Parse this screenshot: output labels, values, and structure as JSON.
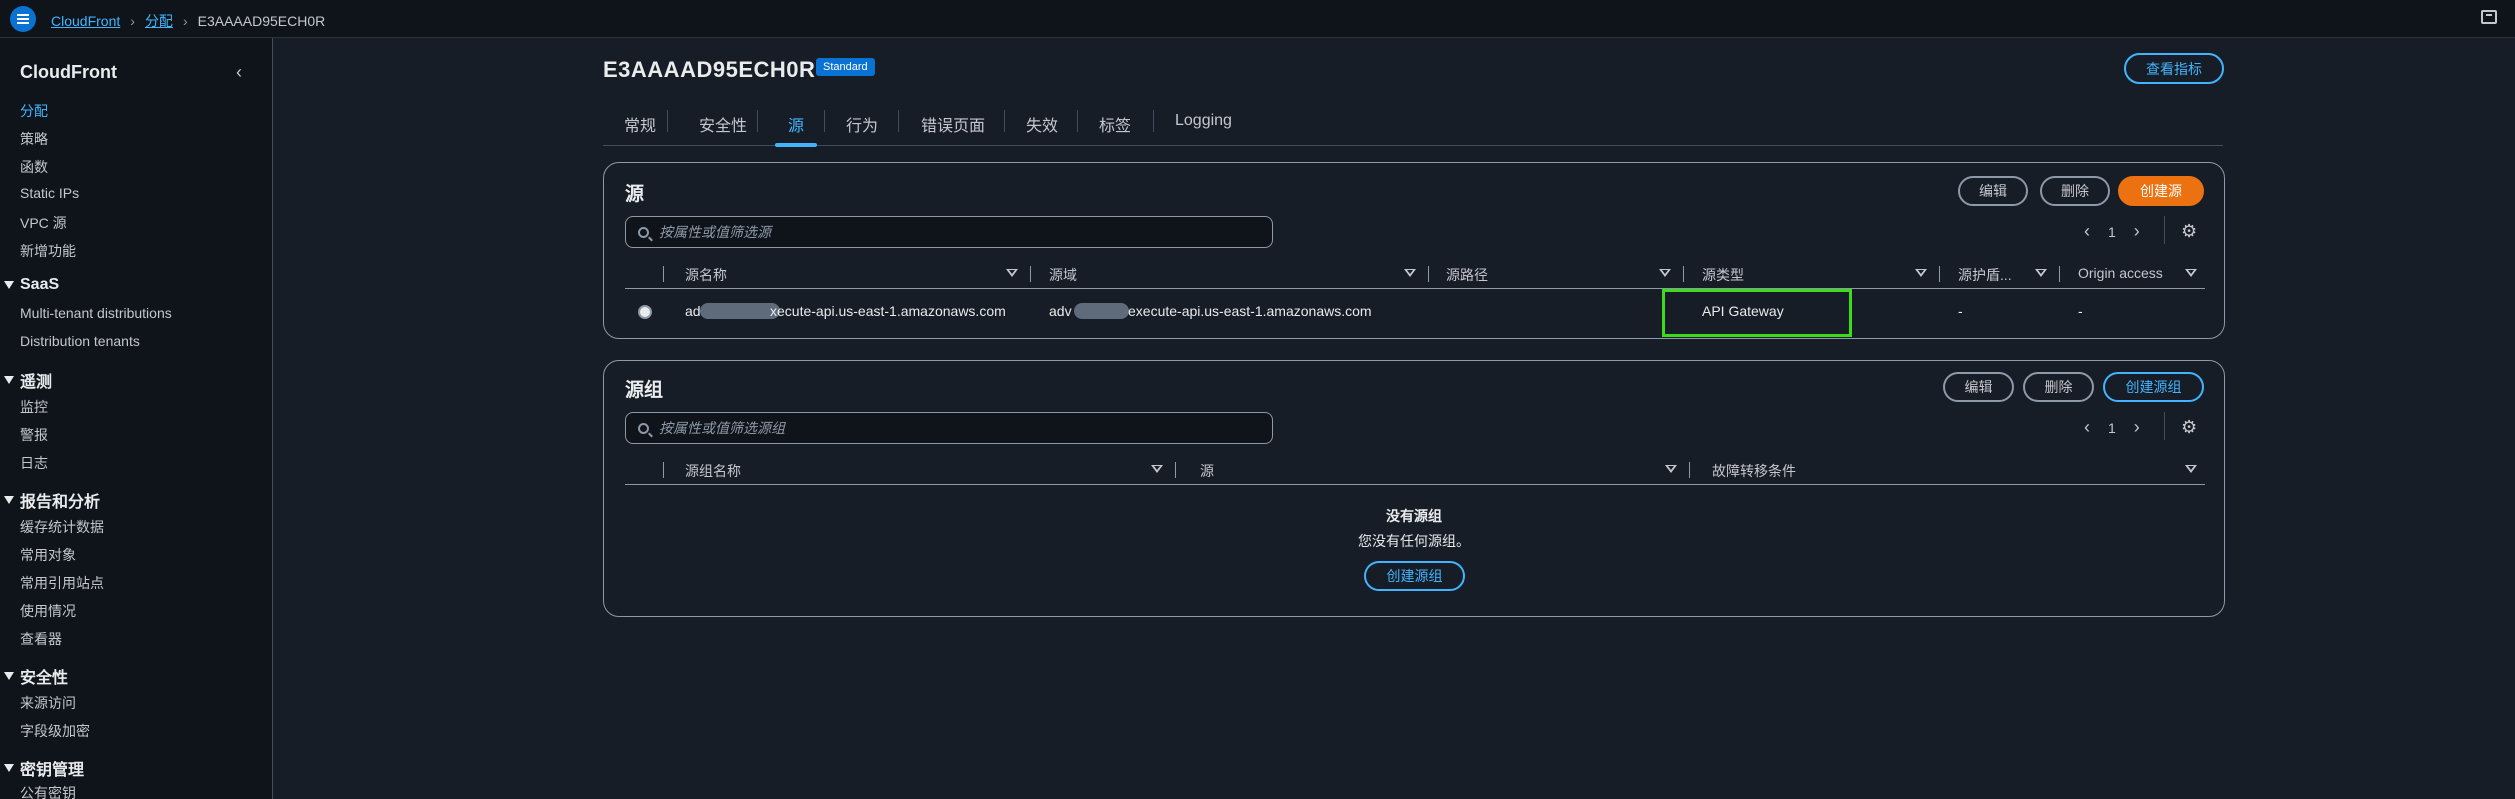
{
  "breadcrumb": {
    "root": "CloudFront",
    "level2": "分配",
    "current": "E3AAAAD95ECH0R"
  },
  "sidebar": {
    "title": "CloudFront",
    "items_top": [
      "分配",
      "策略",
      "函数",
      "Static IPs",
      "VPC 源",
      "新增功能"
    ],
    "saas": {
      "title": "SaaS",
      "items": [
        "Multi-tenant distributions",
        "Distribution tenants"
      ]
    },
    "telemetry": {
      "title": "遥测",
      "items": [
        "监控",
        "警报",
        "日志"
      ]
    },
    "reports": {
      "title": "报告和分析",
      "items": [
        "缓存统计数据",
        "常用对象",
        "常用引用站点",
        "使用情况",
        "查看器"
      ]
    },
    "security": {
      "title": "安全性",
      "items": [
        "来源访问",
        "字段级加密"
      ]
    },
    "keys": {
      "title": "密钥管理",
      "items": [
        "公有密钥"
      ]
    }
  },
  "header": {
    "title": "E3AAAAD95ECH0R",
    "badge": "Standard",
    "metrics_button": "查看指标"
  },
  "tabs": [
    "常规",
    "安全性",
    "源",
    "行为",
    "错误页面",
    "失效",
    "标签",
    "Logging"
  ],
  "origins": {
    "title": "源",
    "edit": "编辑",
    "delete": "删除",
    "create": "创建源",
    "search_placeholder": "按属性或值筛选源",
    "page": "1",
    "columns": [
      "源名称",
      "源域",
      "源路径",
      "源类型",
      "源护盾...",
      "Origin access"
    ],
    "rows": [
      {
        "name_prefix": "ad",
        "name_suffix": "xecute-api.us-east-1.amazonaws.com",
        "domain_prefix": "adv",
        "domain_suffix": "execute-api.us-east-1.amazonaws.com",
        "path": "",
        "type": "API Gateway",
        "shield": "-",
        "access": "-"
      }
    ]
  },
  "origin_groups": {
    "title": "源组",
    "edit": "编辑",
    "delete": "删除",
    "create": "创建源组",
    "search_placeholder": "按属性或值筛选源组",
    "page": "1",
    "columns": [
      "源组名称",
      "源",
      "故障转移条件"
    ],
    "empty_title": "没有源组",
    "empty_desc": "您没有任何源组。",
    "empty_create": "创建源组"
  },
  "colors": {
    "accent": "#42b4ff",
    "primary": "#ff9900",
    "highlight": "#3ddc1a"
  }
}
